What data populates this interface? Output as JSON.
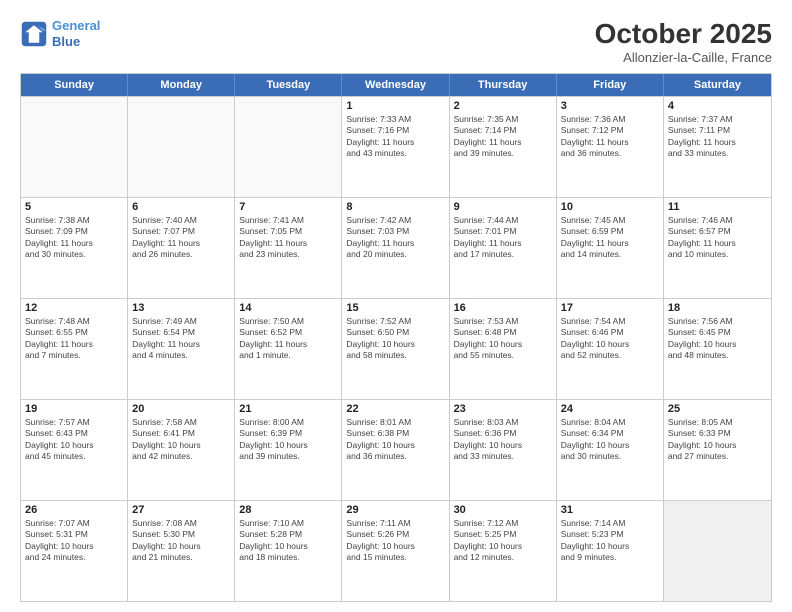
{
  "header": {
    "logo_line1": "General",
    "logo_line2": "Blue",
    "month": "October 2025",
    "location": "Allonzier-la-Caille, France"
  },
  "days_of_week": [
    "Sunday",
    "Monday",
    "Tuesday",
    "Wednesday",
    "Thursday",
    "Friday",
    "Saturday"
  ],
  "rows": [
    [
      {
        "day": "",
        "lines": [],
        "empty": true
      },
      {
        "day": "",
        "lines": [],
        "empty": true
      },
      {
        "day": "",
        "lines": [],
        "empty": true
      },
      {
        "day": "1",
        "lines": [
          "Sunrise: 7:33 AM",
          "Sunset: 7:16 PM",
          "Daylight: 11 hours",
          "and 43 minutes."
        ]
      },
      {
        "day": "2",
        "lines": [
          "Sunrise: 7:35 AM",
          "Sunset: 7:14 PM",
          "Daylight: 11 hours",
          "and 39 minutes."
        ]
      },
      {
        "day": "3",
        "lines": [
          "Sunrise: 7:36 AM",
          "Sunset: 7:12 PM",
          "Daylight: 11 hours",
          "and 36 minutes."
        ]
      },
      {
        "day": "4",
        "lines": [
          "Sunrise: 7:37 AM",
          "Sunset: 7:11 PM",
          "Daylight: 11 hours",
          "and 33 minutes."
        ]
      }
    ],
    [
      {
        "day": "5",
        "lines": [
          "Sunrise: 7:38 AM",
          "Sunset: 7:09 PM",
          "Daylight: 11 hours",
          "and 30 minutes."
        ]
      },
      {
        "day": "6",
        "lines": [
          "Sunrise: 7:40 AM",
          "Sunset: 7:07 PM",
          "Daylight: 11 hours",
          "and 26 minutes."
        ]
      },
      {
        "day": "7",
        "lines": [
          "Sunrise: 7:41 AM",
          "Sunset: 7:05 PM",
          "Daylight: 11 hours",
          "and 23 minutes."
        ]
      },
      {
        "day": "8",
        "lines": [
          "Sunrise: 7:42 AM",
          "Sunset: 7:03 PM",
          "Daylight: 11 hours",
          "and 20 minutes."
        ]
      },
      {
        "day": "9",
        "lines": [
          "Sunrise: 7:44 AM",
          "Sunset: 7:01 PM",
          "Daylight: 11 hours",
          "and 17 minutes."
        ]
      },
      {
        "day": "10",
        "lines": [
          "Sunrise: 7:45 AM",
          "Sunset: 6:59 PM",
          "Daylight: 11 hours",
          "and 14 minutes."
        ]
      },
      {
        "day": "11",
        "lines": [
          "Sunrise: 7:46 AM",
          "Sunset: 6:57 PM",
          "Daylight: 11 hours",
          "and 10 minutes."
        ]
      }
    ],
    [
      {
        "day": "12",
        "lines": [
          "Sunrise: 7:48 AM",
          "Sunset: 6:55 PM",
          "Daylight: 11 hours",
          "and 7 minutes."
        ]
      },
      {
        "day": "13",
        "lines": [
          "Sunrise: 7:49 AM",
          "Sunset: 6:54 PM",
          "Daylight: 11 hours",
          "and 4 minutes."
        ]
      },
      {
        "day": "14",
        "lines": [
          "Sunrise: 7:50 AM",
          "Sunset: 6:52 PM",
          "Daylight: 11 hours",
          "and 1 minute."
        ]
      },
      {
        "day": "15",
        "lines": [
          "Sunrise: 7:52 AM",
          "Sunset: 6:50 PM",
          "Daylight: 10 hours",
          "and 58 minutes."
        ]
      },
      {
        "day": "16",
        "lines": [
          "Sunrise: 7:53 AM",
          "Sunset: 6:48 PM",
          "Daylight: 10 hours",
          "and 55 minutes."
        ]
      },
      {
        "day": "17",
        "lines": [
          "Sunrise: 7:54 AM",
          "Sunset: 6:46 PM",
          "Daylight: 10 hours",
          "and 52 minutes."
        ]
      },
      {
        "day": "18",
        "lines": [
          "Sunrise: 7:56 AM",
          "Sunset: 6:45 PM",
          "Daylight: 10 hours",
          "and 48 minutes."
        ]
      }
    ],
    [
      {
        "day": "19",
        "lines": [
          "Sunrise: 7:57 AM",
          "Sunset: 6:43 PM",
          "Daylight: 10 hours",
          "and 45 minutes."
        ]
      },
      {
        "day": "20",
        "lines": [
          "Sunrise: 7:58 AM",
          "Sunset: 6:41 PM",
          "Daylight: 10 hours",
          "and 42 minutes."
        ]
      },
      {
        "day": "21",
        "lines": [
          "Sunrise: 8:00 AM",
          "Sunset: 6:39 PM",
          "Daylight: 10 hours",
          "and 39 minutes."
        ]
      },
      {
        "day": "22",
        "lines": [
          "Sunrise: 8:01 AM",
          "Sunset: 6:38 PM",
          "Daylight: 10 hours",
          "and 36 minutes."
        ]
      },
      {
        "day": "23",
        "lines": [
          "Sunrise: 8:03 AM",
          "Sunset: 6:36 PM",
          "Daylight: 10 hours",
          "and 33 minutes."
        ]
      },
      {
        "day": "24",
        "lines": [
          "Sunrise: 8:04 AM",
          "Sunset: 6:34 PM",
          "Daylight: 10 hours",
          "and 30 minutes."
        ]
      },
      {
        "day": "25",
        "lines": [
          "Sunrise: 8:05 AM",
          "Sunset: 6:33 PM",
          "Daylight: 10 hours",
          "and 27 minutes."
        ]
      }
    ],
    [
      {
        "day": "26",
        "lines": [
          "Sunrise: 7:07 AM",
          "Sunset: 5:31 PM",
          "Daylight: 10 hours",
          "and 24 minutes."
        ]
      },
      {
        "day": "27",
        "lines": [
          "Sunrise: 7:08 AM",
          "Sunset: 5:30 PM",
          "Daylight: 10 hours",
          "and 21 minutes."
        ]
      },
      {
        "day": "28",
        "lines": [
          "Sunrise: 7:10 AM",
          "Sunset: 5:28 PM",
          "Daylight: 10 hours",
          "and 18 minutes."
        ]
      },
      {
        "day": "29",
        "lines": [
          "Sunrise: 7:11 AM",
          "Sunset: 5:26 PM",
          "Daylight: 10 hours",
          "and 15 minutes."
        ]
      },
      {
        "day": "30",
        "lines": [
          "Sunrise: 7:12 AM",
          "Sunset: 5:25 PM",
          "Daylight: 10 hours",
          "and 12 minutes."
        ]
      },
      {
        "day": "31",
        "lines": [
          "Sunrise: 7:14 AM",
          "Sunset: 5:23 PM",
          "Daylight: 10 hours",
          "and 9 minutes."
        ]
      },
      {
        "day": "",
        "lines": [],
        "empty": true,
        "shaded": true
      }
    ]
  ]
}
